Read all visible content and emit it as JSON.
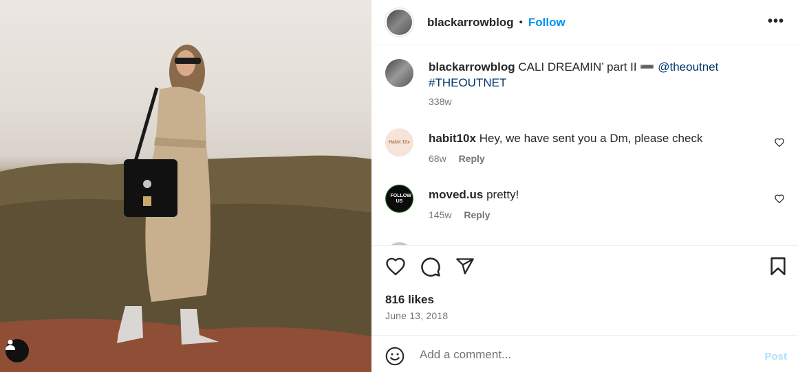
{
  "post": {
    "author": "blackarrowblog",
    "follow_label": "Follow",
    "separator": "•",
    "more_label": "•••"
  },
  "caption": {
    "user": "blackarrowblog",
    "text": "CALI DREAMIN’ part II ➖",
    "mention": "@theoutnet",
    "hashtag": "#THEOUTNET",
    "time": "338w"
  },
  "comments": [
    {
      "user": "habit10x",
      "text": "Hey, we have sent you a Dm, please check",
      "time": "68w",
      "reply_label": "Reply",
      "avatar_text": "Habit 10x"
    },
    {
      "user": "moved.us",
      "text": "pretty!",
      "time": "145w",
      "reply_label": "Reply",
      "avatar_text": "FOLLOW US"
    }
  ],
  "stats": {
    "likes": "816 likes",
    "date": "June 13, 2018"
  },
  "composer": {
    "placeholder": "Add a comment...",
    "post_label": "Post"
  },
  "icons": [
    "heart-icon",
    "comment-icon",
    "share-icon",
    "bookmark-icon",
    "emoji-icon",
    "user-tag-icon",
    "more-icon"
  ],
  "colors": {
    "accent": "#0095f6",
    "link": "#00376b",
    "muted": "#737373",
    "post_disabled": "#b2dffc"
  }
}
